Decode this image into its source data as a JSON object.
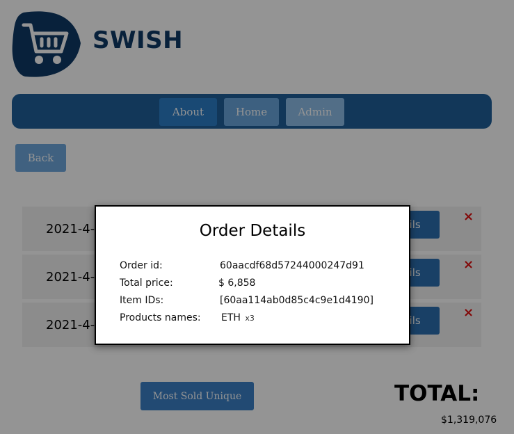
{
  "brand": {
    "name": "SWISH"
  },
  "nav": {
    "about": "About",
    "home": "Home",
    "admin": "Admin"
  },
  "back_label": "Back",
  "orders": [
    {
      "date": "2021-4-",
      "details_label": "ails",
      "remove_icon": "×"
    },
    {
      "date": "2021-4-",
      "details_label": "ails",
      "remove_icon": "×"
    },
    {
      "date": "2021-4-",
      "details_label": "ails",
      "remove_icon": "×"
    }
  ],
  "most_sold_label": "Most Sold Unique",
  "total": {
    "label": "TOTAL:",
    "value": "$1,319,076"
  },
  "modal": {
    "title": "Order Details",
    "order_id_label": "Order id:",
    "order_id": "60aacdf68d57244000247d91",
    "total_price_label": "Total price:",
    "total_price": "$ 6,858",
    "item_ids_label": "Item IDs:",
    "item_ids": "[60aa114ab0d85c4c9e1d4190]",
    "products_names_label": "Products names:",
    "product_name": "ETH",
    "product_qty": "x3"
  },
  "colors": {
    "brand_dark": "#0f3a66",
    "nav_bg": "#1f5f99",
    "remove": "#e10c0c"
  },
  "icons": {
    "logo": "shopping-cart-icon",
    "remove": "close-icon"
  }
}
